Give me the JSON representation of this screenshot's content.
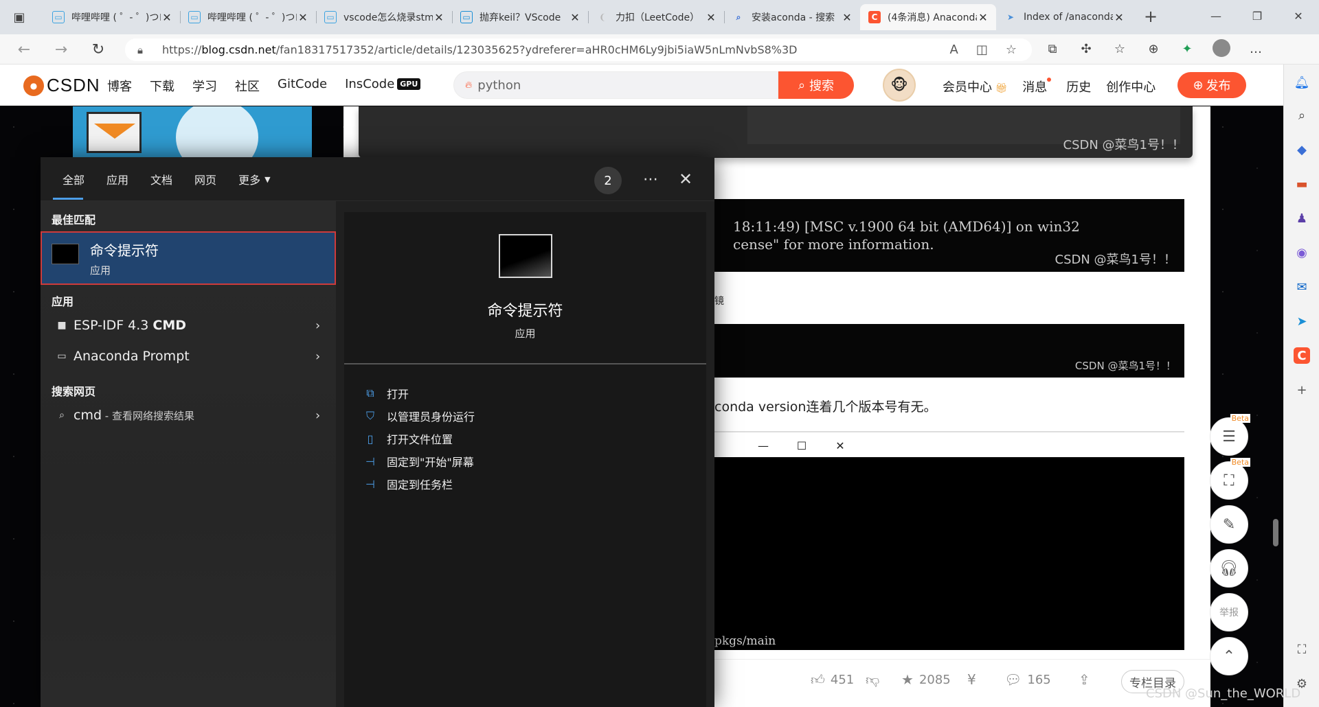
{
  "browser": {
    "tabs": [
      {
        "title": "哔哩哔哩 ( ゜- ゜)つロ",
        "icon": "bilibili-icon",
        "active": false
      },
      {
        "title": "哔哩哔哩 ( ゜- ゜)つロ",
        "icon": "bilibili-icon",
        "active": false
      },
      {
        "title": "vscode怎么烧录stm32",
        "icon": "bilibili-icon",
        "active": false
      },
      {
        "title": "抛弃keil？VScode",
        "icon": "bilibili-icon",
        "active": false
      },
      {
        "title": "力扣（LeetCode）",
        "icon": "leetcode-icon",
        "active": false
      },
      {
        "title": "安装aconda - 搜索",
        "icon": "search-icon",
        "active": false
      },
      {
        "title": "(4条消息) Anaconda",
        "icon": "csdn-icon",
        "active": true
      },
      {
        "title": "Index of /anaconda",
        "icon": "tsinghua-icon",
        "active": false
      }
    ],
    "url_prefix": "https://",
    "url_host": "blog.csdn.net",
    "url_path": "/fan18317517352/article/details/123035625?ydreferer=aHR0cHM6Ly9jbi5iaW5nLmNvbS8%3D"
  },
  "csdn": {
    "logo": "CSDN",
    "nav": [
      "博客",
      "下载",
      "学习",
      "社区",
      "GitCode",
      "InsCode"
    ],
    "gpu_badge": "GPU",
    "search_placeholder": "python",
    "search_button": "搜索",
    "links": [
      "会员中心",
      "消息",
      "历史",
      "创作中心"
    ],
    "publish": "发布"
  },
  "article": {
    "watermark": "CSDN @菜鸟1号！！",
    "code_line1": "18:11:49) [MSC v.1900 64 bit (AMD64)] on win32",
    "code_line2": "cense\" for more information.",
    "text_frag1": "镜",
    "text_frag2": "conda version连着几个版本号有无。",
    "cmd_line": "pkgs/main",
    "actions": {
      "likes": "451",
      "favorites": "2085",
      "comments": "165",
      "toc": "专栏目录"
    },
    "footer_watermark": "CSDN @Sun_the_WORLD",
    "float_beta": "Beta",
    "report": "举报"
  },
  "search_panel": {
    "tabs": [
      "全部",
      "应用",
      "文档",
      "网页",
      "更多"
    ],
    "badge": "2",
    "best_match_header": "最佳匹配",
    "best_match": {
      "name": "命令提示符",
      "type": "应用"
    },
    "apps_header": "应用",
    "apps": [
      {
        "prefix": "ESP-IDF 4.3 ",
        "bold": "CMD"
      },
      {
        "prefix": "Anaconda Prompt",
        "bold": ""
      }
    ],
    "web_header": "搜索网页",
    "web": {
      "term": "cmd",
      "desc": " - 查看网络搜索结果"
    },
    "preview": {
      "name": "命令提示符",
      "type": "应用"
    },
    "actions": [
      "打开",
      "以管理员身份运行",
      "打开文件位置",
      "固定到\"开始\"屏幕",
      "固定到任务栏"
    ]
  }
}
